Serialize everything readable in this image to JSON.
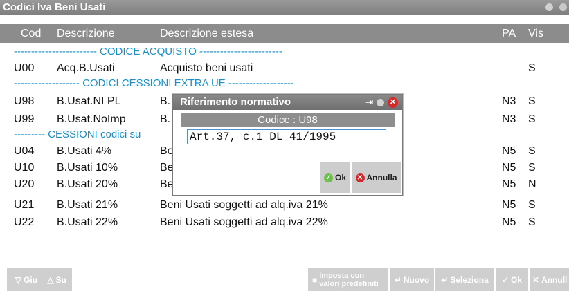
{
  "window": {
    "title": "Codici Iva Beni Usati"
  },
  "columns": {
    "cod": "Cod",
    "descrizione": "Descrizione",
    "estesa": "Descrizione estesa",
    "pa": "PA",
    "vis": "Vis"
  },
  "rows": [
    {
      "type": "sep",
      "text": "------------------------ CODICE ACQUISTO ------------------------"
    },
    {
      "type": "data",
      "cod": "U00",
      "desc": "Acq.B.Usati",
      "ext": "Acquisto beni usati",
      "pa": "",
      "vis": "S"
    },
    {
      "type": "sep",
      "text": "------------------- CODICI CESSIONI EXTRA UE -------------------"
    },
    {
      "type": "data",
      "cod": "U98",
      "desc": "B.Usat.NI PL",
      "ext": "B.",
      "pa": "N3",
      "vis": "S"
    },
    {
      "type": "data",
      "cod": "U99",
      "desc": "B.Usat.NoImp",
      "ext": "B.",
      "pa": "N3",
      "vis": "S"
    },
    {
      "type": "sep",
      "text": "--------- CESSIONI codici su"
    },
    {
      "type": "data",
      "cod": "U04",
      "desc": "B.Usati  4%",
      "ext": "Be",
      "pa": "N5",
      "vis": "S"
    },
    {
      "type": "data",
      "cod": "U10",
      "desc": "B.Usati 10%",
      "ext": "Be",
      "pa": "N5",
      "vis": "S"
    },
    {
      "type": "data",
      "cod": "U20",
      "desc": "B.Usati 20%",
      "ext": "Be",
      "pa": "N5",
      "vis": "N"
    },
    {
      "type": "data",
      "cod": "U21",
      "desc": "B.Usati 21%",
      "ext": "Beni Usati soggetti ad alq.iva 21%",
      "pa": "N5",
      "vis": "S"
    },
    {
      "type": "data",
      "cod": "U22",
      "desc": "B.Usati 22%",
      "ext": "Beni Usati soggetti ad alq.iva 22%",
      "pa": "N5",
      "vis": "S"
    }
  ],
  "dialog": {
    "title": "Riferimento normativo",
    "subtitle": "Codice : U98",
    "value": "Art.37, c.1 DL 41/1995",
    "ok": "Ok",
    "cancel": "Annulla"
  },
  "footer": {
    "giu": "Giu",
    "su": "Su",
    "imposta_line1": "Imposta con",
    "imposta_line2": "valori predefiniti",
    "nuovo": "Nuovo",
    "seleziona": "Seleziona",
    "ok": "Ok",
    "annulla": "Annull"
  },
  "icons": {
    "pin": "pin-icon",
    "dot": "circle-icon",
    "close": "close-icon",
    "down": "arrow-down-icon",
    "up": "arrow-up-icon",
    "enter": "enter-icon",
    "check": "check-icon"
  },
  "colors": {
    "accent": "#1a8fc9",
    "header": "#8c8c8c",
    "danger": "#d62828",
    "ok": "#6cc04a"
  }
}
